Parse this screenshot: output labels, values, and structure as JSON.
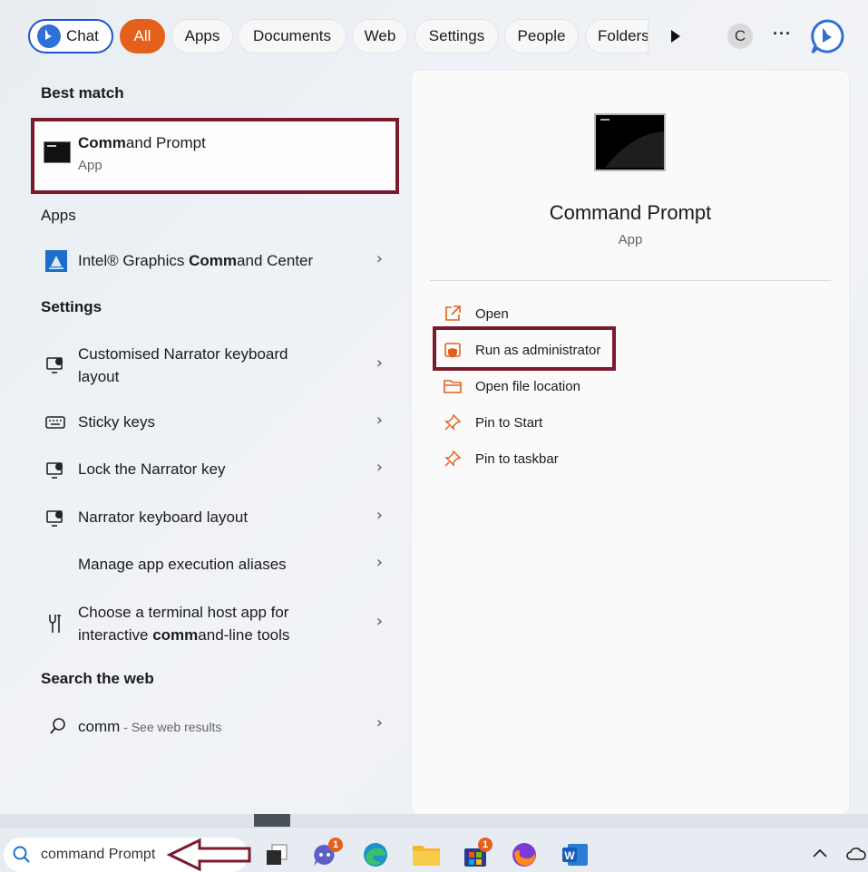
{
  "filters": {
    "chat": "Chat",
    "all": "All",
    "apps": "Apps",
    "documents": "Documents",
    "web": "Web",
    "settings": "Settings",
    "people": "People",
    "folders": "Folders",
    "avatar_letter": "C",
    "more": "···"
  },
  "best_match": {
    "heading": "Best match",
    "title_bold": "Comm",
    "title_rest": "and Prompt",
    "subtitle": "App"
  },
  "apps": {
    "heading": "Apps",
    "items": [
      {
        "pre": "Intel® Graphics ",
        "bold": "Comm",
        "post": "and Center"
      }
    ]
  },
  "settings": {
    "heading": "Settings",
    "items": [
      {
        "line1": "Customised Narrator keyboard",
        "line2": "layout"
      },
      {
        "label": "Sticky keys"
      },
      {
        "label": "Lock the Narrator key"
      },
      {
        "label": "Narrator keyboard layout"
      },
      {
        "label": "Manage app execution aliases"
      },
      {
        "line1": "Choose a terminal host app for",
        "line2_pre": "interactive ",
        "line2_bold": "comm",
        "line2_post": "and-line tools"
      }
    ]
  },
  "web": {
    "heading": "Search the web",
    "query": "comm",
    "suffix": " - See web results"
  },
  "detail": {
    "title": "Command Prompt",
    "subtitle": "App",
    "actions": [
      {
        "label": "Open",
        "icon": "open-external-icon"
      },
      {
        "label": "Run as administrator",
        "icon": "shield-admin-icon"
      },
      {
        "label": "Open file location",
        "icon": "folder-icon"
      },
      {
        "label": "Pin to Start",
        "icon": "pin-icon"
      },
      {
        "label": "Pin to taskbar",
        "icon": "pin-icon"
      }
    ]
  },
  "taskbar": {
    "search_text": "command Prompt",
    "teams_badge": "1",
    "store_badge": "1"
  },
  "colors": {
    "accent": "#e5611b",
    "highlight_border": "#7b1a2c",
    "chat_border": "#1f55c8"
  }
}
